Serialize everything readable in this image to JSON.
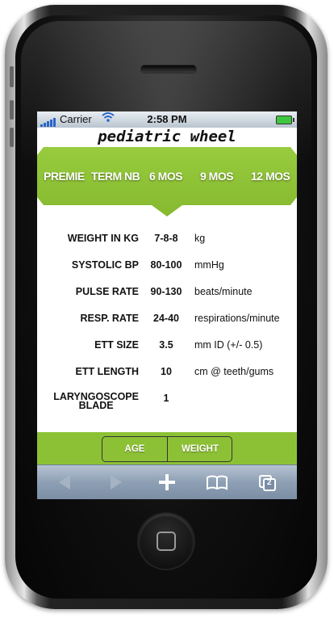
{
  "status_bar": {
    "carrier": "Carrier",
    "time": "2:58 PM"
  },
  "app": {
    "title": "pediatric wheel"
  },
  "age_tabs": [
    "PREMIE",
    "TERM NB",
    "6 MOS",
    "9 MOS",
    "12 MOS"
  ],
  "selected_tab": "6 MOS",
  "rows": [
    {
      "label": "WEIGHT IN KG",
      "value": "7-8-8",
      "unit": "kg"
    },
    {
      "label": "SYSTOLIC BP",
      "value": "80-100",
      "unit": "mmHg"
    },
    {
      "label": "PULSE RATE",
      "value": "90-130",
      "unit": "beats/minute"
    },
    {
      "label": "RESP. RATE",
      "value": "24-40",
      "unit": "respirations/minute"
    },
    {
      "label": "ETT SIZE",
      "value": "3.5",
      "unit": "mm ID (+/- 0.5)"
    },
    {
      "label": "ETT LENGTH",
      "value": "10",
      "unit": "cm @ teeth/gums"
    },
    {
      "label_line1": "LARYNGOSCOPE",
      "label_line2": "BLADE",
      "value": "1",
      "unit": ""
    }
  ],
  "segmented": {
    "left_label": "AGE",
    "right_label": "WEIGHT"
  },
  "browser_toolbar": {
    "pages_count": "2",
    "icons": [
      "back-icon",
      "forward-icon",
      "plus-icon",
      "bookmarks-icon",
      "pages-icon"
    ]
  },
  "colors": {
    "accent": "#8dc135",
    "toolbar": "#8d9fb4"
  }
}
